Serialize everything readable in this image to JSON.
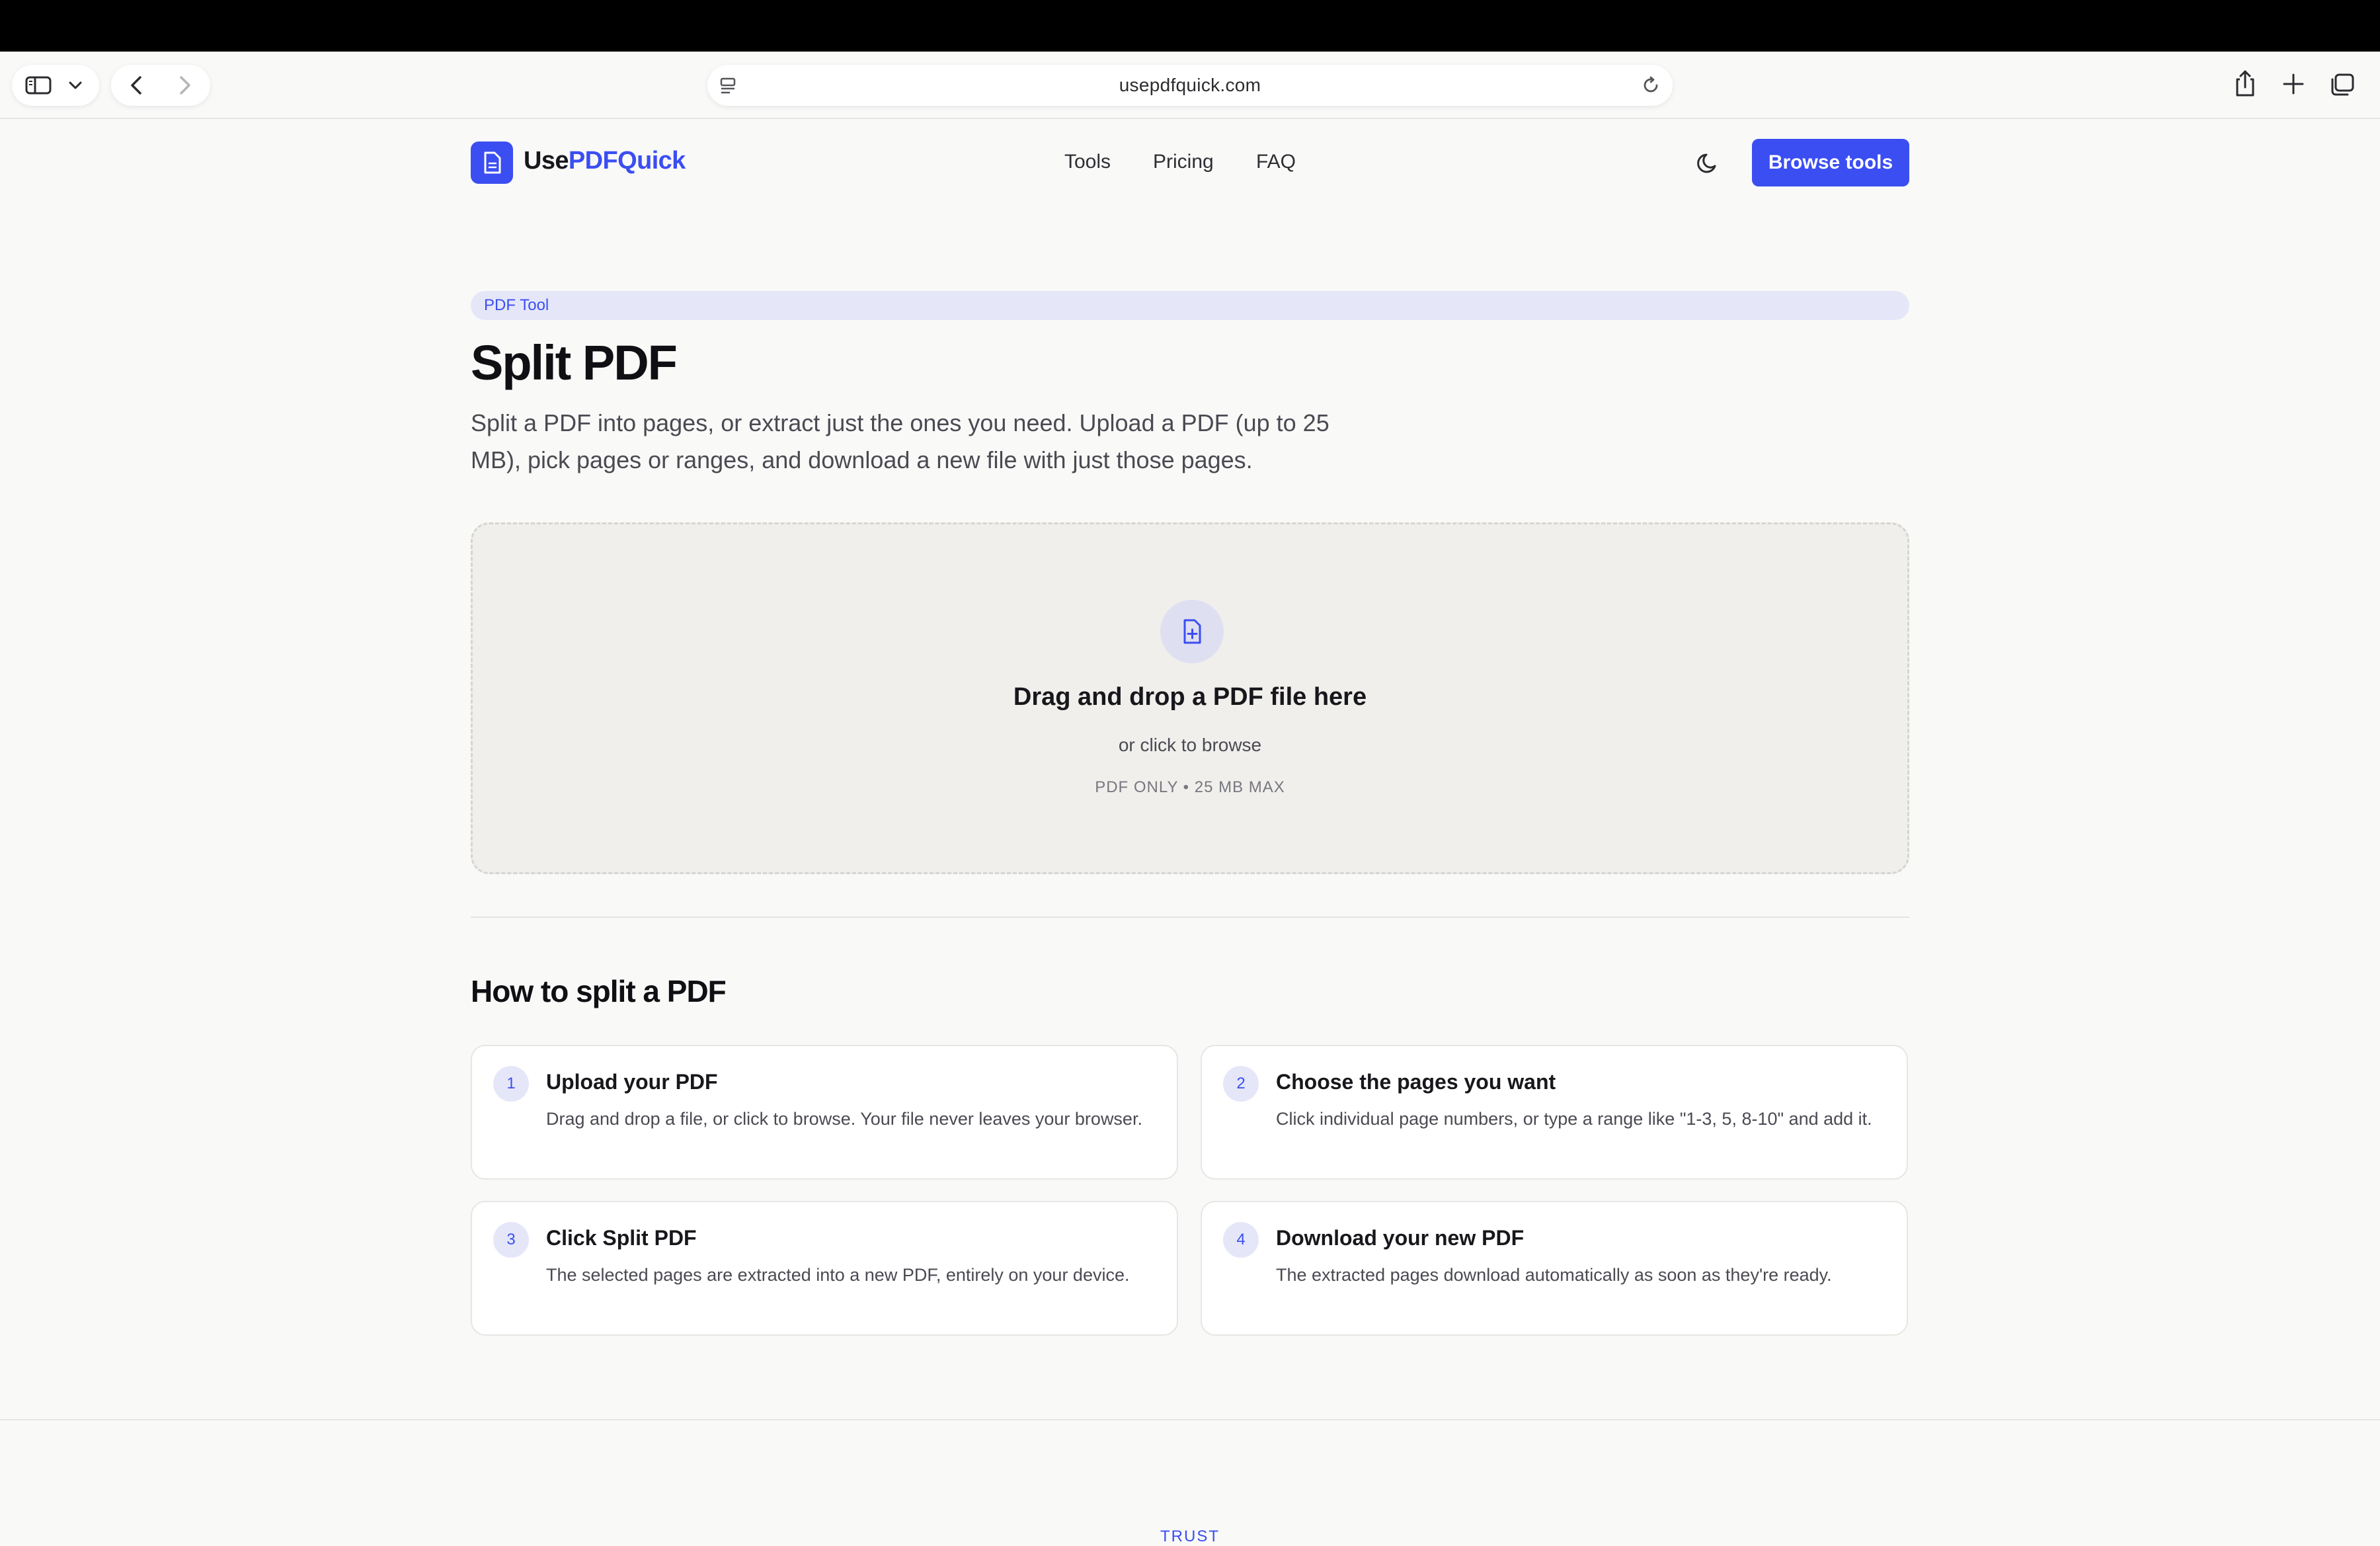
{
  "browser": {
    "url": "usepdfquick.com"
  },
  "header": {
    "logo_prefix": "Use",
    "logo_suffix": "PDFQuick",
    "nav": [
      "Tools",
      "Pricing",
      "FAQ"
    ],
    "cta_label": "Browse tools"
  },
  "hero": {
    "badge": "PDF Tool",
    "title": "Split PDF",
    "description": "Split a PDF into pages, or extract just the ones you need. Upload a PDF (up to 25 MB), pick pages or ranges, and download a new file with just those pages."
  },
  "dropzone": {
    "title": "Drag and drop a PDF file here",
    "subtitle": "or click to browse",
    "meta": "PDF ONLY • 25 MB MAX"
  },
  "howto": {
    "title": "How to split a PDF",
    "steps": [
      {
        "num": "1",
        "title": "Upload your PDF",
        "text": "Drag and drop a file, or click to browse. Your file never leaves your browser."
      },
      {
        "num": "2",
        "title": "Choose the pages you want",
        "text": "Click individual page numbers, or type a range like \"1-3, 5, 8-10\" and add it."
      },
      {
        "num": "3",
        "title": "Click Split PDF",
        "text": "The selected pages are extracted into a new PDF, entirely on your device."
      },
      {
        "num": "4",
        "title": "Download your new PDF",
        "text": "The extracted pages download automatically as soon as they're ready."
      }
    ]
  },
  "footer": {
    "section_label": "TRUST"
  },
  "colors": {
    "accent": "#3b4ef2",
    "background": "#f9f9f8",
    "dropzone_bg": "#f0efec"
  }
}
